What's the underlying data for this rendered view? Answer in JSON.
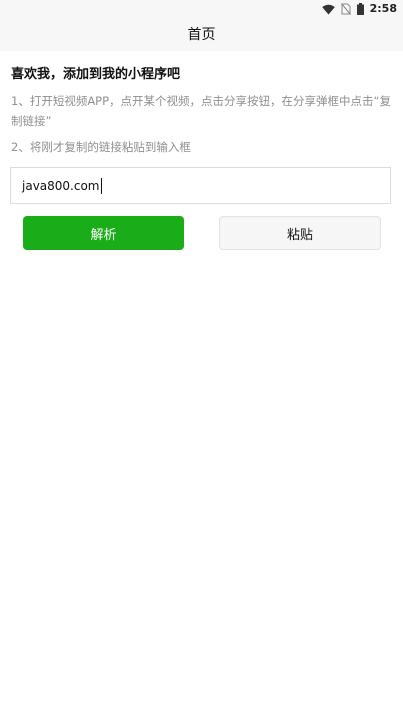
{
  "status_bar": {
    "time": "2:58",
    "icons": [
      "wifi-icon",
      "no-sim-icon",
      "battery-icon"
    ]
  },
  "nav": {
    "title": "首页"
  },
  "main": {
    "heading": "喜欢我，添加到我的小程序吧",
    "instruction_1": "1、打开短视频APP，点开某个视频，点击分享按钮，在分享弹框中点击“复制链接”",
    "instruction_2": "2、将刚才复制的链接粘贴到输入框",
    "url_input_value": "java800.com",
    "parse_button_label": "解析",
    "paste_button_label": "粘贴"
  },
  "colors": {
    "primary_green": "#1aad19",
    "nav_background": "#f7f7f7",
    "instruction_text": "#8f8f8f"
  }
}
